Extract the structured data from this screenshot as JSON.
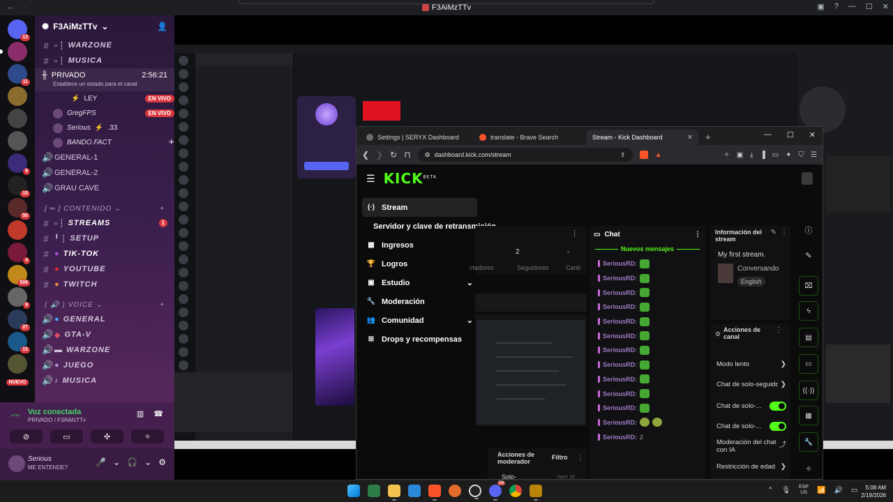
{
  "discord": {
    "window_title": "F3AiMzTTv",
    "guild_name": "F3AiMzTTv",
    "server_badges": [
      "13",
      "11",
      "9",
      "15",
      "50",
      "4",
      "506",
      "9",
      "27",
      "15"
    ],
    "new_label": "NUEVO",
    "channels_top": [
      {
        "name": "WARZONE",
        "style": "italic"
      },
      {
        "name": "MUSICA",
        "style": "italic"
      }
    ],
    "voice_active": {
      "name": "PRIVADO",
      "timer": "2:56:21",
      "status": "Establece un estado para el canal",
      "users": [
        {
          "name": "LEY",
          "live": "EN VIVO"
        },
        {
          "name": "GregFPS",
          "live": "EN VIVO"
        },
        {
          "name": "Serious",
          "extra": ".33"
        },
        {
          "name": "BANDO.FACT",
          "extra": ""
        }
      ]
    },
    "channels_mid": [
      "GENERAL-1",
      "GENERAL-2",
      "GRAU CAVE"
    ],
    "cat_content": "CONTENIDO",
    "channels_content": [
      {
        "name": "STREAMS",
        "count": "1"
      },
      {
        "name": "SETUP",
        "count": ""
      },
      {
        "name": "TIK-TOK",
        "count": ""
      },
      {
        "name": "YOUTUBE",
        "count": ""
      },
      {
        "name": "TWITCH",
        "count": ""
      }
    ],
    "cat_voice": "VOICE",
    "channels_voice": [
      "GENERAL",
      "GTA-V",
      "WARZONE",
      "JUEGO",
      "MUSICA"
    ],
    "voice_panel": {
      "title": "Voz conectada",
      "subtitle": "PRIVADO / F3AiMzTTv"
    },
    "user_panel": {
      "name": "Serious",
      "status": "ME ENTENDE?"
    }
  },
  "browser": {
    "tabs": [
      {
        "title": "Settings | SERYX Dashboard",
        "icon": "settings-icon"
      },
      {
        "title": "translate - Brave Search",
        "icon": "brave-icon"
      },
      {
        "title": "Stream - Kick Dashboard",
        "icon": "kick-icon",
        "active": true
      }
    ],
    "url": "dashboard.kick.com/stream"
  },
  "kick": {
    "logo": "KICK",
    "beta": "BETA",
    "nav": [
      {
        "label": "Stream",
        "icon": "stream-icon",
        "selected": true
      },
      {
        "label": "Servidor y clave de retransmisión",
        "sub": true
      },
      {
        "label": "Ingresos",
        "icon": "chart-icon"
      },
      {
        "label": "Logros",
        "icon": "trophy-icon"
      },
      {
        "label": "Estudio",
        "icon": "studio-icon",
        "expand": true
      },
      {
        "label": "Moderación",
        "icon": "wrench-icon"
      },
      {
        "label": "Comunidad",
        "icon": "community-icon",
        "expand": true
      },
      {
        "label": "Drops y recompensas",
        "icon": "drops-icon"
      }
    ],
    "stats": {
      "value1": "2",
      "value2": "-",
      "label1": "ctadores",
      "label2": "Seguidores",
      "label3": "Canti"
    },
    "chat": {
      "title": "Chat",
      "new_messages": "Nuevos mensajes",
      "username": "SeriousRD:",
      "message_count": 13,
      "last_text": "2"
    },
    "info": {
      "title": "Información del stream",
      "stream_title": "My first stream.",
      "category": "Conversando",
      "language": "English"
    },
    "actions": {
      "title": "Acciones de canal",
      "rows": [
        {
          "label": "Modo lento",
          "control": "chevron"
        },
        {
          "label": "Chat de solo-seguidores",
          "control": "chevron"
        },
        {
          "label": "Chat de solo-...",
          "control": "toggle",
          "on": true
        },
        {
          "label": "Chat de solo-...",
          "control": "toggle",
          "on": true
        },
        {
          "label": "Moderación del chat con IA",
          "control": "external"
        },
        {
          "label": "Restricción de edad",
          "control": "chevron"
        }
      ]
    },
    "mod_actions": {
      "title": "Acciones de moderador",
      "filter": "Filtro",
      "row": "Solo-",
      "ago": "hace 16"
    }
  },
  "taskbar": {
    "lang_top": "ESP",
    "lang_bottom": "US",
    "time": "5:08 AM",
    "date": "2/19/2026",
    "discord_badge": "59"
  },
  "colors": {
    "kick_green": "#53fc18",
    "live_red": "#da373c",
    "discord_bg": "#1e1f22"
  }
}
